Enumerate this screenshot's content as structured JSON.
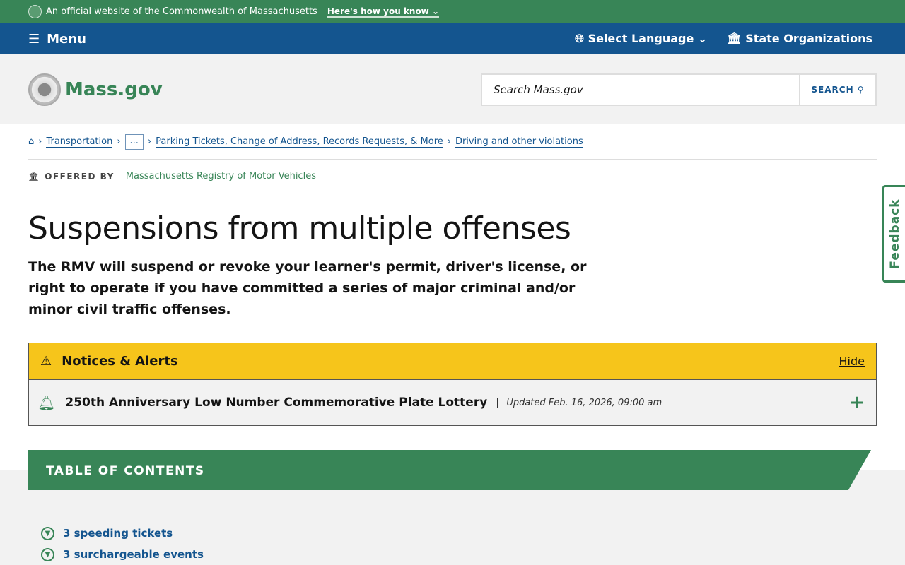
{
  "topbar": {
    "official": "An official website of the Commonwealth of Massachusetts",
    "how": "Here's how you know"
  },
  "nav": {
    "menu": "Menu",
    "language": "Select Language",
    "orgs": "State Organizations"
  },
  "header": {
    "logo": "Mass.gov",
    "search_placeholder": "Search Mass.gov",
    "search_button": "SEARCH"
  },
  "breadcrumbs": [
    "Transportation",
    "...",
    "Parking Tickets, Change of Address, Records Requests, & More",
    "Driving and other violations"
  ],
  "offered": {
    "label": "OFFERED BY",
    "org": "Massachusetts Registry of Motor Vehicles"
  },
  "page": {
    "title": "Suspensions from multiple offenses",
    "lede": "The RMV will suspend or revoke your learner's permit, driver's license, or right to operate if you have committed a series of major criminal and/or minor civil traffic offenses."
  },
  "alerts": {
    "heading": "Notices & Alerts",
    "hide": "Hide",
    "items": [
      {
        "title": "250th Anniversary Low Number Commemorative Plate Lottery",
        "updated": "Updated Feb. 16, 2026, 09:00 am"
      }
    ]
  },
  "toc": {
    "heading": "TABLE OF CONTENTS",
    "items": [
      "3 speeding tickets",
      "3 surchargeable events"
    ]
  },
  "feedback": "Feedback"
}
